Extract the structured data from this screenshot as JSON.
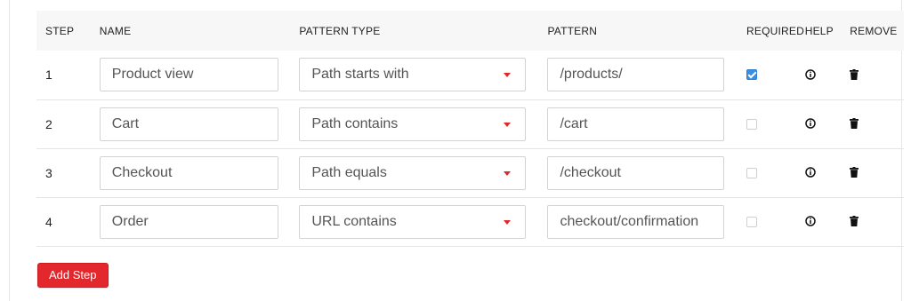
{
  "headers": {
    "step": "STEP",
    "name": "NAME",
    "pattern_type": "PATTERN TYPE",
    "pattern": "PATTERN",
    "required": "REQUIRED",
    "help": "HELP",
    "remove": "REMOVE"
  },
  "rows": [
    {
      "step": "1",
      "name": "Product view",
      "pattern_type": "Path starts with",
      "pattern": "/products/",
      "required": true
    },
    {
      "step": "2",
      "name": "Cart",
      "pattern_type": "Path contains",
      "pattern": "/cart",
      "required": false
    },
    {
      "step": "3",
      "name": "Checkout",
      "pattern_type": "Path equals",
      "pattern": "/checkout",
      "required": false
    },
    {
      "step": "4",
      "name": "Order",
      "pattern_type": "URL contains",
      "pattern": "checkout/confirmation",
      "required": false
    }
  ],
  "icons": {
    "dropdown": "caret-down-icon",
    "help": "info-circle-icon",
    "remove": "trash-icon"
  },
  "colors": {
    "accent": "#e2282c",
    "checkbox_checked": "#3b8ee0"
  },
  "actions": {
    "add_step_label": "Add Step"
  }
}
